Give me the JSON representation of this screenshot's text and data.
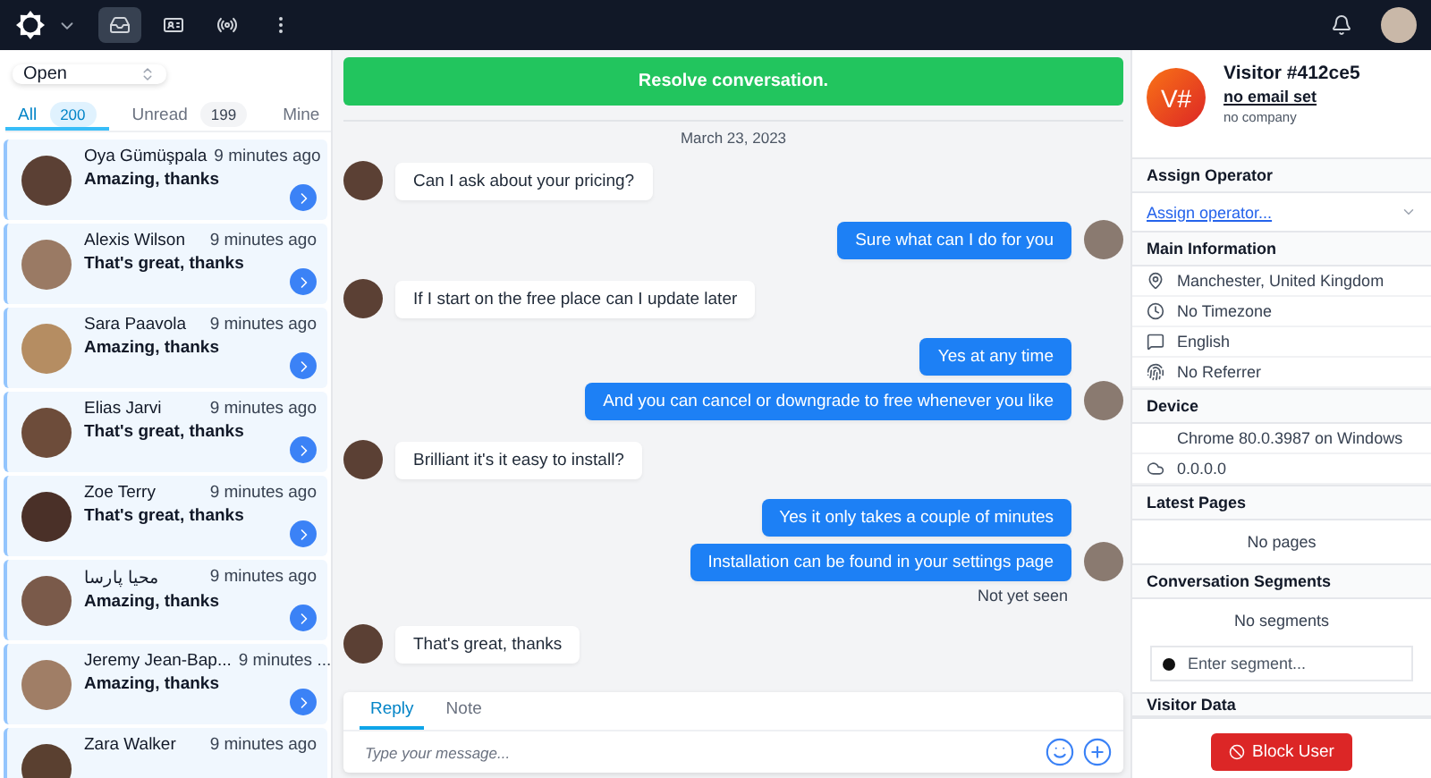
{
  "topbar": {
    "nav": [
      {
        "kind": "inbox",
        "selected": true
      },
      {
        "kind": "contacts",
        "selected": false
      },
      {
        "kind": "broadcast",
        "selected": false
      },
      {
        "kind": "more",
        "selected": false
      }
    ]
  },
  "filter": {
    "value": "Open"
  },
  "tabs": [
    {
      "label": "All",
      "count": "200",
      "selected": true
    },
    {
      "label": "Unread",
      "count": "199",
      "selected": false
    },
    {
      "label": "Mine",
      "selected": false
    }
  ],
  "conversations": [
    {
      "name": "Oya Gümüşpala",
      "time": "9 minutes ago",
      "message": "Amazing, thanks"
    },
    {
      "name": "Alexis Wilson",
      "time": "9 minutes ago",
      "message": "That's great, thanks"
    },
    {
      "name": "Sara Paavola",
      "time": "9 minutes ago",
      "message": "Amazing, thanks"
    },
    {
      "name": "Elias Jarvi",
      "time": "9 minutes ago",
      "message": "That's great, thanks"
    },
    {
      "name": "Zoe Terry",
      "time": "9 minutes ago",
      "message": "That's great, thanks"
    },
    {
      "name": "محیا پارسا",
      "time": "9 minutes ago",
      "message": "Amazing, thanks"
    },
    {
      "name": "Jeremy Jean-Bap...",
      "time": "9 minutes ...",
      "message": "Amazing, thanks"
    },
    {
      "name": "Zara Walker",
      "time": "9 minutes ago"
    }
  ],
  "chat": {
    "resolve_button": "Resolve conversation.",
    "date": "March 23, 2023",
    "messages": [
      {
        "kind": "visitor",
        "text": "Can I ask about your pricing?",
        "show_avatar": true
      },
      {
        "kind": "operator",
        "text": "Sure what can I do for you",
        "show_avatar": true
      },
      {
        "kind": "visitor",
        "text": "If I start on the free place can I update later",
        "show_avatar": true
      },
      {
        "kind": "operator",
        "text": "Yes at any time",
        "show_avatar": false
      },
      {
        "kind": "operator",
        "text": "And you can cancel or downgrade to free whenever you like",
        "show_avatar": true
      },
      {
        "kind": "visitor",
        "text": "Brilliant it's it easy to install?",
        "show_avatar": true
      },
      {
        "kind": "operator",
        "text": "Yes it only takes a couple of minutes",
        "show_avatar": false
      },
      {
        "kind": "operator",
        "text": "Installation can be found in your settings page",
        "show_avatar": true,
        "status": "Not yet seen"
      },
      {
        "kind": "visitor",
        "text": "That's great, thanks",
        "show_avatar": true
      }
    ],
    "composer": {
      "tabs": [
        {
          "label": "Reply",
          "selected": true
        },
        {
          "label": "Note",
          "selected": false
        }
      ],
      "placeholder": "Type your message..."
    }
  },
  "visitor": {
    "initials": "V#",
    "name": "Visitor #412ce5",
    "email": "no email set",
    "company": "no company",
    "sections": [
      {
        "title": "Assign Operator",
        "rows": [
          {
            "kind": "select",
            "text": "Assign operator..."
          }
        ]
      },
      {
        "title": "Main Information",
        "rows": [
          {
            "kind": "location",
            "text": "Manchester, United Kingdom"
          },
          {
            "kind": "timezone",
            "text": "No Timezone"
          },
          {
            "kind": "language",
            "text": "English"
          },
          {
            "kind": "referrer",
            "text": "No Referrer"
          }
        ]
      },
      {
        "title": "Device",
        "rows": [
          {
            "kind": "browser",
            "text": "Chrome 80.0.3987 on Windows"
          },
          {
            "kind": "ip",
            "text": "0.0.0.0"
          }
        ]
      },
      {
        "title": "Latest Pages",
        "rows": [
          {
            "kind": "empty",
            "text": "No pages"
          }
        ]
      },
      {
        "title": "Conversation Segments",
        "rows": [
          {
            "kind": "empty",
            "text": "No segments"
          },
          {
            "kind": "segment-input",
            "placeholder": "Enter segment..."
          }
        ]
      },
      {
        "title": "Visitor Data"
      }
    ],
    "block_button": "Block User"
  }
}
